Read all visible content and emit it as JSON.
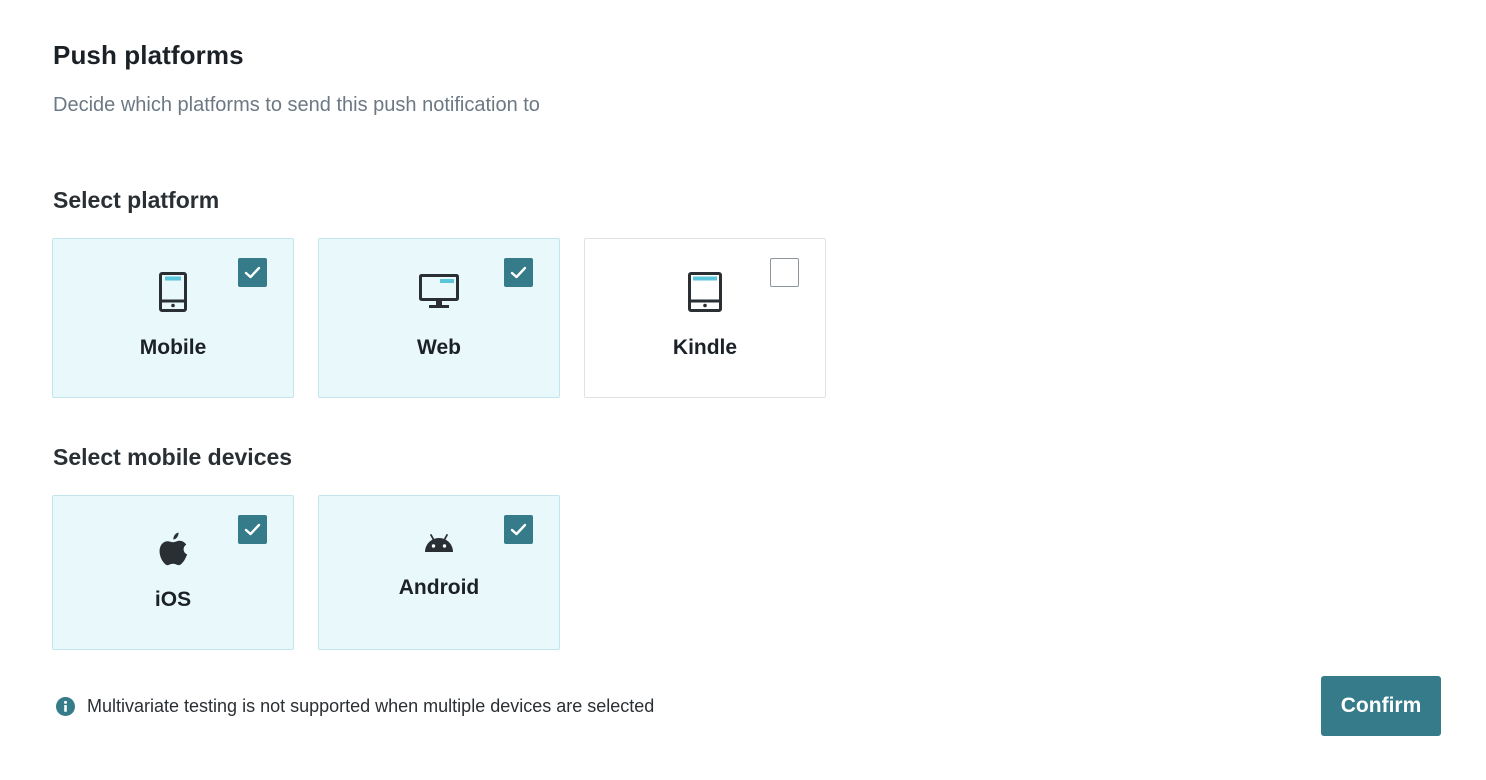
{
  "header": {
    "title": "Push platforms",
    "subtitle": "Decide which platforms to send this push notification to"
  },
  "platform_section": {
    "heading": "Select platform",
    "options": [
      {
        "label": "Mobile",
        "icon": "mobile-phone-icon",
        "checked": true
      },
      {
        "label": "Web",
        "icon": "desktop-monitor-icon",
        "checked": true
      },
      {
        "label": "Kindle",
        "icon": "kindle-tablet-icon",
        "checked": false
      }
    ]
  },
  "devices_section": {
    "heading": "Select mobile devices",
    "options": [
      {
        "label": "iOS",
        "icon": "apple-icon",
        "checked": true
      },
      {
        "label": "Android",
        "icon": "android-icon",
        "checked": true
      }
    ]
  },
  "footer": {
    "info_text": "Multivariate testing is not supported when multiple devices are selected",
    "info_icon": "info-icon",
    "confirm_label": "Confirm"
  },
  "colors": {
    "accent": "#367b8a",
    "selected_card_bg": "#e8f8fb",
    "icon_highlight": "#5bc5d9",
    "heading_text": "#1b2126",
    "subtitle_text": "#6c7884"
  }
}
